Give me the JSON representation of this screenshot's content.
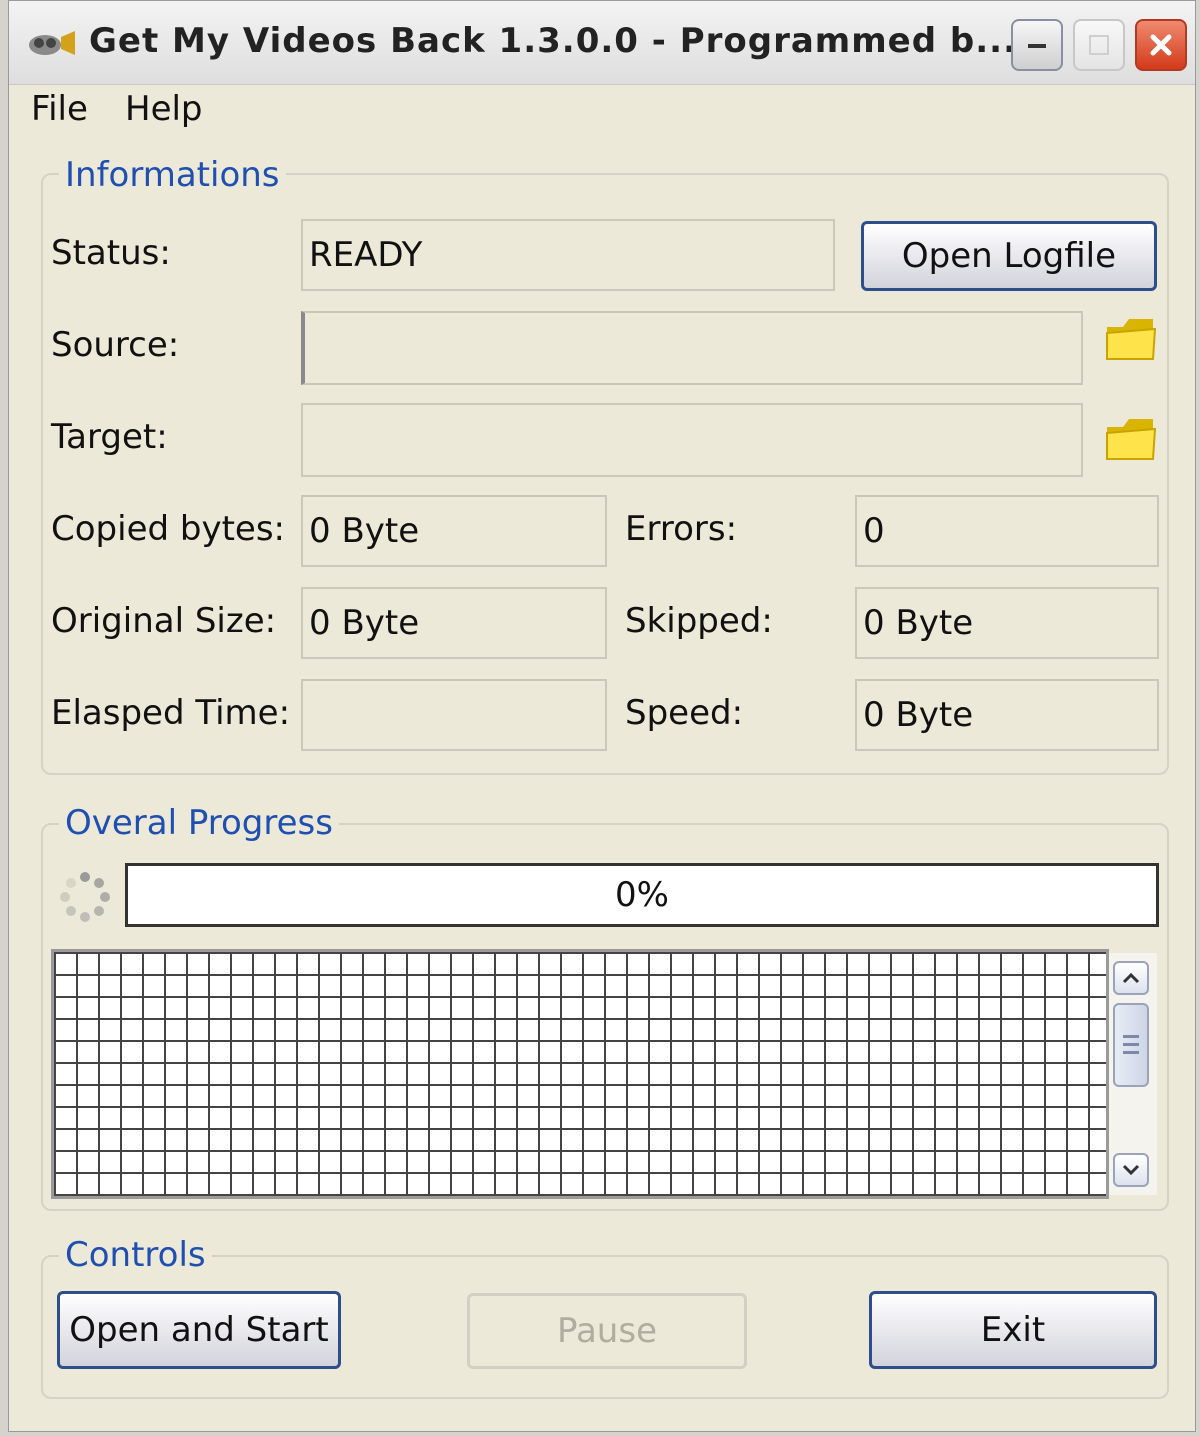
{
  "window": {
    "title": "Get My Videos Back 1.3.0.0 - Programmed b...",
    "icon": "app-icon",
    "controls": [
      "minimize-icon",
      "maximize-icon",
      "close-icon"
    ]
  },
  "menu": {
    "items": [
      {
        "label": "File"
      },
      {
        "label": "Help"
      }
    ]
  },
  "informations": {
    "title": "Informations",
    "status_label": "Status:",
    "status_value": "READY",
    "open_logfile_label": "Open Logfile",
    "source_label": "Source:",
    "source_value": "",
    "target_label": "Target:",
    "target_value": "",
    "copied_bytes_label": "Copied bytes:",
    "copied_bytes_value": "0 Byte",
    "errors_label": "Errors:",
    "errors_value": "0",
    "original_size_label": "Original Size:",
    "original_size_value": "0 Byte",
    "skipped_label": "Skipped:",
    "skipped_value": "0 Byte",
    "elapsed_time_label": "Elasped Time:",
    "elapsed_time_value": "",
    "speed_label": "Speed:",
    "speed_value": "0 Byte",
    "browse_icon": "folder-icon"
  },
  "progress": {
    "title": "Overal Progress",
    "percent_text": "0%",
    "percent": 0
  },
  "controls": {
    "title": "Controls",
    "open_and_start_label": "Open and Start",
    "pause_label": "Pause",
    "exit_label": "Exit"
  },
  "colors": {
    "accent": "#1f4fb0",
    "close_button": "#d23a1a",
    "window_bg": "#ece9d8"
  }
}
